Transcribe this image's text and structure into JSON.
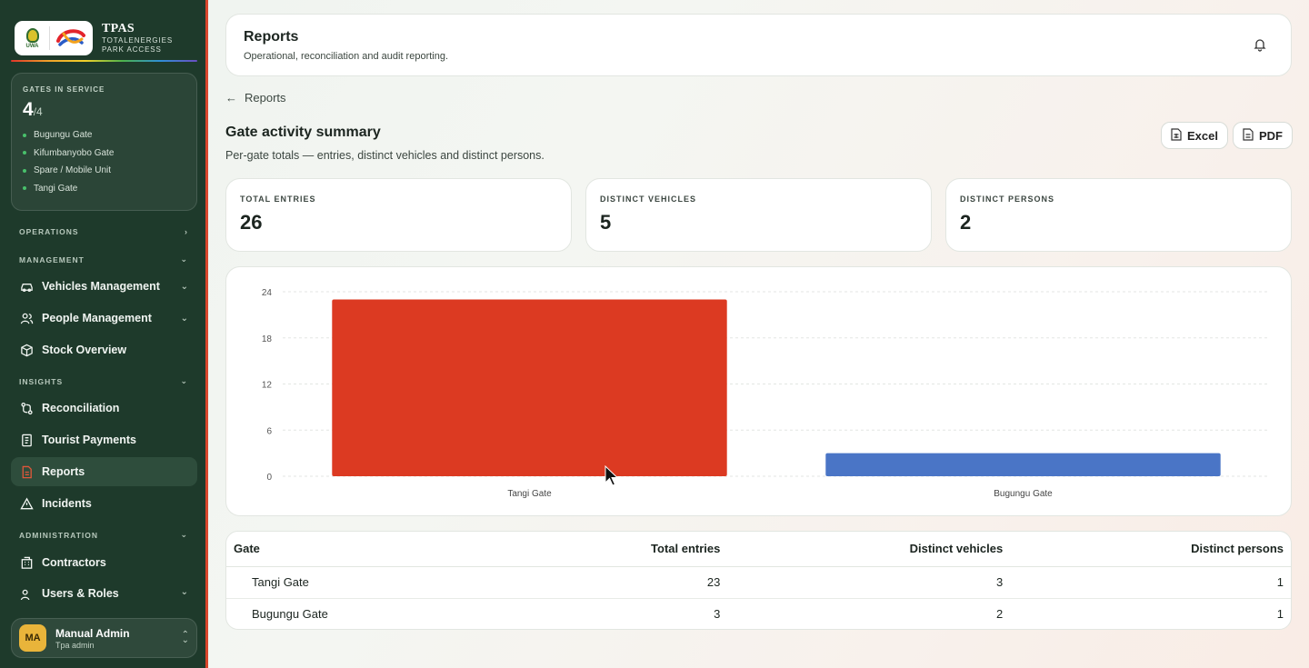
{
  "brand": {
    "title": "TPAS",
    "subtitle_line1": "TOTALENERGIES",
    "subtitle_line2": "PARK ACCESS",
    "uwa_text": "UWA"
  },
  "gates_card": {
    "label": "GATES IN SERVICE",
    "count": "4",
    "total": "/4",
    "gates": [
      "Bugungu Gate",
      "Kifumbanyobo Gate",
      "Spare / Mobile Unit",
      "Tangi Gate"
    ],
    "status_color": "#49c06b"
  },
  "nav": {
    "operations": "OPERATIONS",
    "management": "MANAGEMENT",
    "vehicles": "Vehicles Management",
    "people": "People Management",
    "stock": "Stock Overview",
    "insights": "INSIGHTS",
    "reconciliation": "Reconciliation",
    "payments": "Tourist Payments",
    "reports": "Reports",
    "incidents": "Incidents",
    "administration": "ADMINISTRATION",
    "contractors": "Contractors",
    "users": "Users & Roles"
  },
  "user": {
    "initials": "MA",
    "name": "Manual Admin",
    "role": "Tpa admin"
  },
  "header": {
    "title": "Reports",
    "subtitle": "Operational, reconciliation and audit reporting."
  },
  "breadcrumb": {
    "back_label": "Reports"
  },
  "summary": {
    "title": "Gate activity summary",
    "subtitle": "Per-gate totals — entries, distinct vehicles and distinct persons.",
    "excel_label": "Excel",
    "pdf_label": "PDF"
  },
  "kpis": [
    {
      "label": "TOTAL ENTRIES",
      "value": "26"
    },
    {
      "label": "DISTINCT VEHICLES",
      "value": "5"
    },
    {
      "label": "DISTINCT PERSONS",
      "value": "2"
    }
  ],
  "chart_data": {
    "type": "bar",
    "categories": [
      "Tangi Gate",
      "Bugungu Gate"
    ],
    "values": [
      23,
      3
    ],
    "colors": [
      "#dc3a22",
      "#4a75c6"
    ],
    "title": "",
    "xlabel": "",
    "ylabel": "",
    "ylim": [
      0,
      24
    ],
    "yticks": [
      0,
      6,
      12,
      18,
      24
    ],
    "grid": true
  },
  "table": {
    "headers": [
      "Gate",
      "Total entries",
      "Distinct vehicles",
      "Distinct persons"
    ],
    "rows": [
      [
        "Tangi Gate",
        "23",
        "3",
        "1"
      ],
      [
        "Bugungu Gate",
        "3",
        "2",
        "1"
      ]
    ]
  }
}
